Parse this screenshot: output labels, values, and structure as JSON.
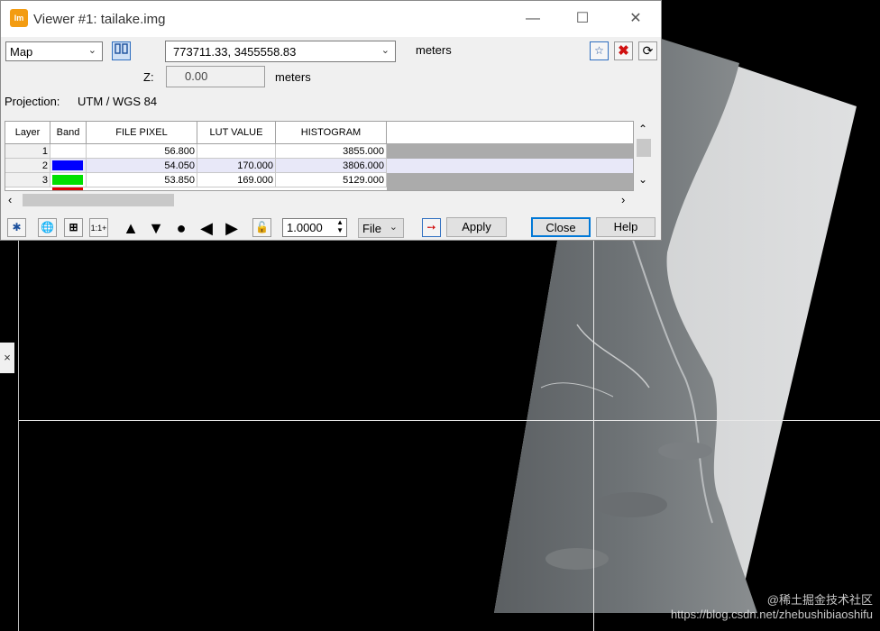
{
  "window": {
    "logo_text": "Im",
    "title": "Viewer #1:   tailake.img",
    "minimize_glyph": "—",
    "maximize_glyph": "☐",
    "close_glyph": "✕"
  },
  "coords": {
    "mode_select": "Map",
    "coordinate_value": "773711.33,  3455558.83",
    "units": "meters",
    "z_label": "Z:",
    "z_value": "0.00",
    "z_units": "meters",
    "projection_label": "Projection:",
    "projection_value": "UTM / WGS 84"
  },
  "table": {
    "headers": [
      "Layer",
      "Band",
      "FILE PIXEL",
      "LUT VALUE",
      "HISTOGRAM"
    ],
    "rows": [
      {
        "layer": "1",
        "band_color": "#ffffff",
        "file_pixel": "56.800",
        "lut_value": "",
        "histogram": "3855.000"
      },
      {
        "layer": "2",
        "band_color": "#0000ff",
        "file_pixel": "54.050",
        "lut_value": "170.000",
        "histogram": "3806.000"
      },
      {
        "layer": "3",
        "band_color": "#00e000",
        "file_pixel": "53.850",
        "lut_value": "169.000",
        "histogram": "5129.000"
      }
    ]
  },
  "toolbar": {
    "zoom_value": "1.0000",
    "file_select": "File",
    "apply_label": "Apply",
    "close_label": "Close",
    "help_label": "Help"
  },
  "side": {
    "close_tab_glyph": "×"
  },
  "watermark": {
    "line1": "@稀土掘金技术社区",
    "line2": "https://blog.csdn.net/zhebushibiaoshifu"
  }
}
